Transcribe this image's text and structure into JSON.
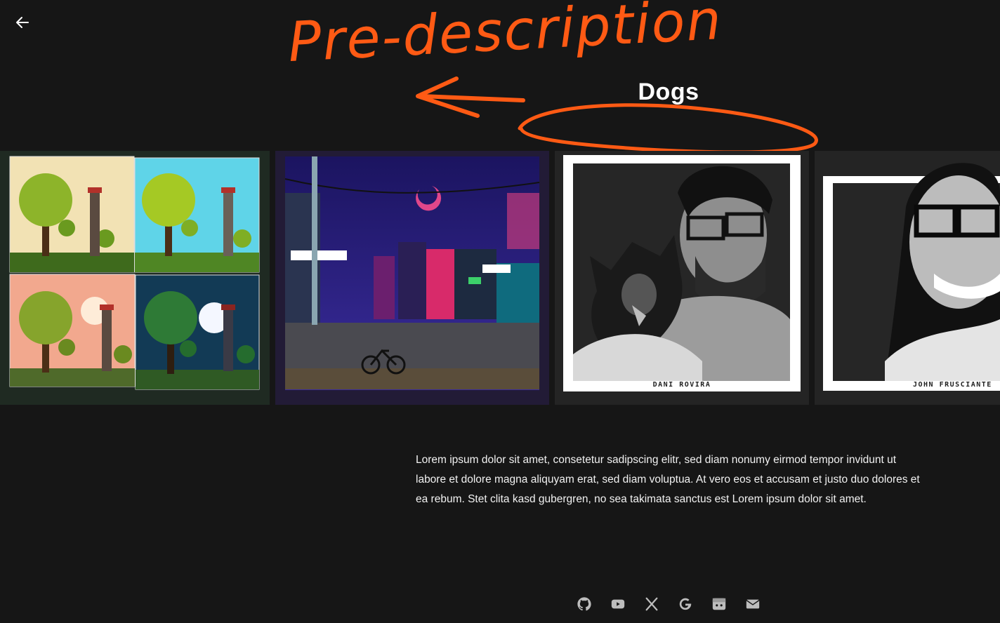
{
  "header": {
    "back_icon": "arrow-left-icon",
    "title": "Dogs"
  },
  "annotation": {
    "text": "Pre-description"
  },
  "gallery": {
    "items": [
      {
        "type": "tree-tower-seasons-pixel-art"
      },
      {
        "type": "night-city-pixel-art"
      },
      {
        "type": "portrait-with-dog-pixel-art",
        "caption": "DANI ROVIRA"
      },
      {
        "type": "portrait-pixel-art",
        "caption": "JOHN FRUSCIANTE"
      }
    ]
  },
  "description": {
    "text": "Lorem ipsum dolor sit amet, consetetur sadipscing elitr, sed diam nonumy eirmod tempor invidunt ut labore et dolore magna aliquyam erat, sed diam voluptua. At vero eos et accusam et justo duo dolores et ea rebum. Stet clita kasd gubergren, no sea takimata sanctus est Lorem ipsum dolor sit amet."
  },
  "footer": {
    "icons": [
      "github-icon",
      "youtube-icon",
      "x-icon",
      "google-icon",
      "discord-icon",
      "mail-icon"
    ]
  },
  "colors": {
    "background": "#161616",
    "annotation": "#ff5a14",
    "text": "#ffffff"
  }
}
